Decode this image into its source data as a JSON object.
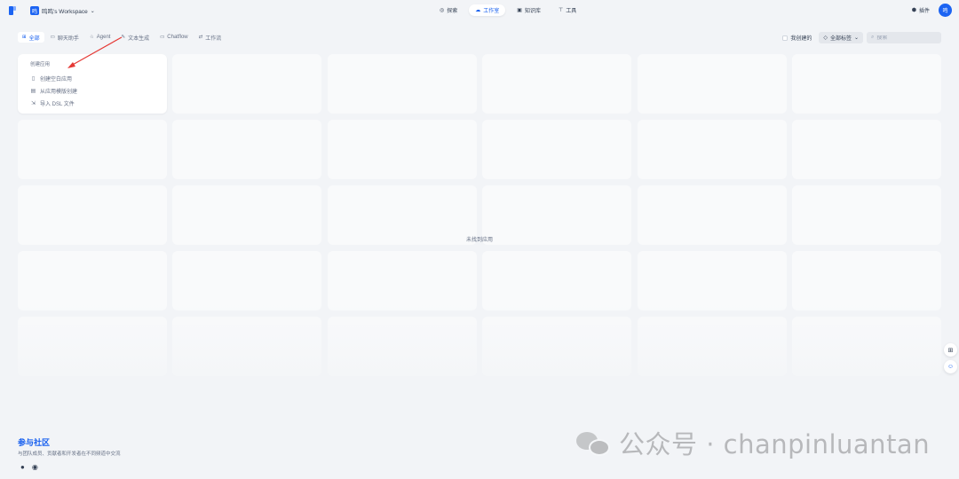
{
  "topbar": {
    "workspace_avatar": "鸣",
    "workspace_name": "鸣鸣's Workspace",
    "nav": [
      {
        "label": "探索",
        "icon": "compass-icon",
        "active": false
      },
      {
        "label": "工作室",
        "icon": "cloud-icon",
        "active": true
      },
      {
        "label": "知识库",
        "icon": "book-icon",
        "active": false
      },
      {
        "label": "工具",
        "icon": "tool-icon",
        "active": false
      }
    ],
    "plugin_label": "插件",
    "user_avatar": "鸣"
  },
  "filters": {
    "tabs": [
      {
        "label": "全部",
        "icon": "grid-icon",
        "active": true
      },
      {
        "label": "聊天助手",
        "icon": "chat-icon",
        "active": false
      },
      {
        "label": "Agent",
        "icon": "agent-icon",
        "active": false
      },
      {
        "label": "文本生成",
        "icon": "edit-icon",
        "active": false
      },
      {
        "label": "Chatflow",
        "icon": "chatflow-icon",
        "active": false
      },
      {
        "label": "工作流",
        "icon": "workflow-icon",
        "active": false
      }
    ],
    "mine_label": "我创建的",
    "tag_select_label": "全部标签",
    "search_placeholder": "搜索"
  },
  "create_card": {
    "title": "创建应用",
    "items": [
      {
        "label": "创建空白应用",
        "icon": "file-icon"
      },
      {
        "label": "从应用模版创建",
        "icon": "template-icon"
      },
      {
        "label": "导入 DSL 文件",
        "icon": "import-icon"
      }
    ]
  },
  "empty_message": "未找到应用",
  "community": {
    "title": "参与社区",
    "description": "与团队成员、贡献者和开发者在不同频道中交流"
  },
  "watermark": "公众号 · chanpinluantan",
  "colors": {
    "accent": "#155eef",
    "background": "#f2f4f7",
    "card": "#f9fafb"
  }
}
